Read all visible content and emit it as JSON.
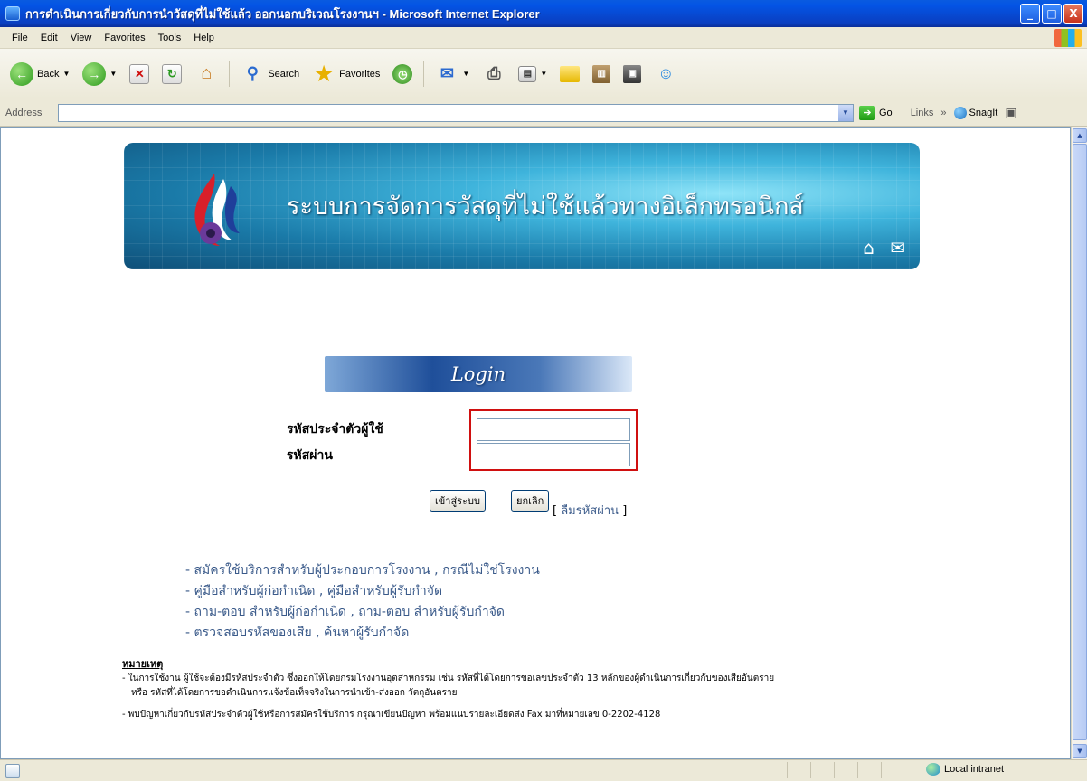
{
  "window": {
    "title": "การดำเนินการเกี่ยวกับการนำวัสดุที่ไม่ใช้แล้ว ออกนอกบริเวณโรงงานฯ - Microsoft Internet Explorer",
    "min": "_",
    "max": "□",
    "close": "X"
  },
  "menu": [
    "File",
    "Edit",
    "View",
    "Favorites",
    "Tools",
    "Help"
  ],
  "toolbar": {
    "back": "Back",
    "search": "Search",
    "favorites": "Favorites"
  },
  "address": {
    "label": "Address",
    "value": "",
    "go": "Go",
    "links": "Links",
    "more": "»",
    "snagit": "SnagIt"
  },
  "banner": {
    "title": "ระบบการจัดการวัสดุที่ไม่ใช้แล้วทางอิเล็กทรอนิกส์"
  },
  "login": {
    "header": "Login",
    "user_label": "รหัสประจำตัวผู้ใช้",
    "pass_label": "รหัสผ่าน",
    "user_value": "",
    "pass_value": "",
    "submit": "เข้าสู่ระบบ",
    "cancel": "ยกเลิก",
    "forgot_open": "[",
    "forgot": "ลืมรหัสผ่าน",
    "forgot_close": "]"
  },
  "links": [
    {
      "prefix": "- ",
      "items": [
        "สมัครใช้บริการสำหรับผู้ประกอบการโรงงาน",
        "กรณีไม่ใช่โรงงาน"
      ]
    },
    {
      "prefix": "- ",
      "items": [
        "คู่มือสำหรับผู้ก่อกำเนิด",
        "คู่มือสำหรับผู้รับกำจัด"
      ]
    },
    {
      "prefix": "- ",
      "items": [
        "ถาม-ตอบ สำหรับผู้ก่อกำเนิด",
        "ถาม-ตอบ สำหรับผู้รับกำจัด"
      ]
    },
    {
      "prefix": "- ",
      "items": [
        "ตรวจสอบรหัสของเสีย",
        "ค้นหาผู้รับกำจัด"
      ]
    }
  ],
  "link_separator": " , ",
  "notes": {
    "title": "หมายเหตุ",
    "line1": "- ในการใช้งาน ผู้ใช้จะต้องมีรหัสประจำตัว ซึ่งออกให้โดยกรมโรงงานอุตสาหกรรม เช่น รหัสที่ได้โดยการขอเลขประจำตัว 13 หลักของผู้ดำเนินการเกี่ยวกับของเสียอันตราย",
    "line2": "หรือ รหัสที่ได้โดยการขอดำเนินการแจ้งข้อเท็จจริงในการนำเข้า-ส่งออก วัตถุอันตราย",
    "line3": "- พบปัญหาเกี่ยวกับรหัสประจำตัวผู้ใช้หรือการสมัครใช้บริการ กรุณาเขียนปัญหา พร้อมแนบรายละเอียดส่ง Fax มาที่หมายเลข 0-2202-4128"
  },
  "status": {
    "zone": "Local intranet"
  },
  "colors": {
    "title_bar": "#0a5be0",
    "link": "#3a5a8a",
    "highlight_border": "#d01010"
  }
}
